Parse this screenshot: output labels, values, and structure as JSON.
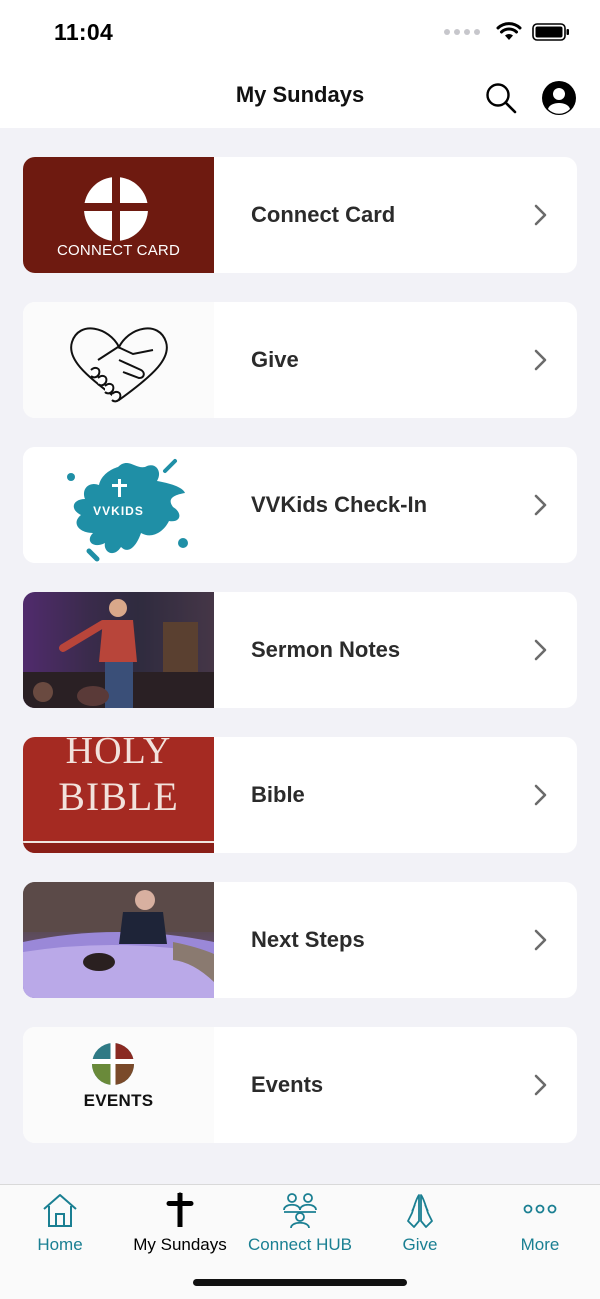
{
  "status_bar": {
    "time": "11:04"
  },
  "nav": {
    "title": "My Sundays"
  },
  "items": [
    {
      "label": "Connect Card",
      "thumb_caption": "CONNECT CARD"
    },
    {
      "label": "Give"
    },
    {
      "label": "VVKids Check-In",
      "thumb_caption": "VVKIDS"
    },
    {
      "label": "Sermon Notes"
    },
    {
      "label": "Bible",
      "thumb_line1": "HOLY",
      "thumb_line2": "BIBLE"
    },
    {
      "label": "Next Steps"
    },
    {
      "label": "Events",
      "thumb_caption": "EVENTS"
    }
  ],
  "tabs": [
    {
      "label": "Home",
      "icon": "house-icon"
    },
    {
      "label": "My Sundays",
      "icon": "cross-icon",
      "active": true
    },
    {
      "label": "Connect HUB",
      "icon": "people-icon"
    },
    {
      "label": "Give",
      "icon": "praying-hands-icon"
    },
    {
      "label": "More",
      "icon": "ellipsis-icon"
    }
  ],
  "colors": {
    "accent": "#1a7f92",
    "connect_card_bg": "#6e1a10",
    "bible_red": "#a52a22",
    "splash_teal": "#1f8fa6"
  }
}
